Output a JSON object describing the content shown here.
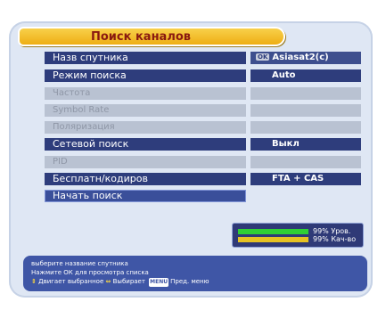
{
  "window": {
    "title": "Поиск каналов"
  },
  "menu": {
    "items": [
      {
        "label": "Назв спутника",
        "state": "active"
      },
      {
        "label": "Режим поиска",
        "state": "active"
      },
      {
        "label": "Частота",
        "state": "disabled"
      },
      {
        "label": "Symbol Rate",
        "state": "disabled"
      },
      {
        "label": "Поляризация",
        "state": "disabled"
      },
      {
        "label": "Сетевой поиск",
        "state": "active"
      },
      {
        "label": "PID",
        "state": "disabled"
      },
      {
        "label": "Бесплатн/кодиров",
        "state": "active"
      },
      {
        "label": "Начать поиск",
        "state": "selected"
      }
    ]
  },
  "values": {
    "satellite_ok": "OK",
    "satellite": "Asiasat2(c)",
    "search_mode": "Auto",
    "network_search": "Выкл",
    "fta_cas": "FTA + CAS"
  },
  "signal": {
    "level_text": "99% Уров.",
    "quality_text": "99% Кач-во",
    "level": 99,
    "quality": 99,
    "level_color": "#2fcf35",
    "quality_color": "#e6c222"
  },
  "help": {
    "line1": "выберите название спутника",
    "line2": "Нажмите ОК для просмотра списка",
    "move_icon": "up-down-arrows-icon",
    "move_text": "Двигает выбранное",
    "select_icon": "left-right-arrows-icon",
    "select_text": "Выбирает",
    "menu_key": "MENU",
    "menu_text": "Пред. меню"
  },
  "colors": {
    "title_tab": "#eeae14",
    "row_active": "#2e3d7c",
    "row_disabled": "#b9c2d2",
    "panel": "#dfe7f4",
    "help_bg": "#3f56a6"
  }
}
